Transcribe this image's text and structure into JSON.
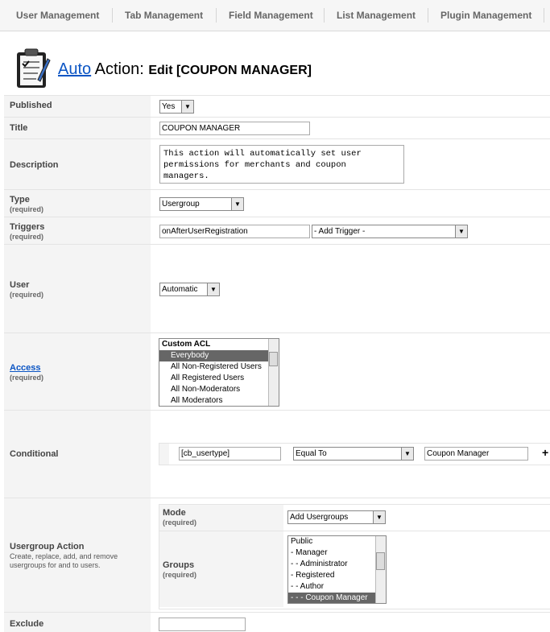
{
  "nav": {
    "tabs": [
      "User Management",
      "Tab Management",
      "Field Management",
      "List Management",
      "Plugin Management"
    ]
  },
  "header": {
    "title_link": "Auto",
    "title_word": "Action:",
    "title_sub": "Edit [COUPON MANAGER]"
  },
  "required_text": "(required)",
  "form": {
    "published": {
      "label": "Published",
      "value": "Yes"
    },
    "title": {
      "label": "Title",
      "value": "COUPON MANAGER"
    },
    "description": {
      "label": "Description",
      "value": "This action will automatically set user\npermissions for merchants and coupon\nmanagers."
    },
    "type": {
      "label": "Type",
      "value": "Usergroup"
    },
    "triggers": {
      "label": "Triggers",
      "value": "onAfterUserRegistration",
      "add_trigger": "- Add Trigger -"
    },
    "user": {
      "label": "User",
      "value": "Automatic"
    },
    "access": {
      "label": "Access",
      "options": [
        "Custom ACL",
        "Everybody",
        "All Non-Registered Users",
        "All Registered Users",
        "All Non-Moderators",
        "All Moderators"
      ],
      "selected": "Everybody"
    },
    "conditional": {
      "label": "Conditional",
      "field": "[cb_usertype]",
      "operator": "Equal To",
      "value": "Coupon Manager",
      "add_symbol": "+"
    },
    "usergroup_action": {
      "label": "Usergroup Action",
      "description": "Create, replace, add, and remove usergroups for and to users.",
      "mode_label": "Mode",
      "mode_value": "Add Usergroups",
      "groups_label": "Groups",
      "groups": [
        "Public",
        "- Manager",
        "- - Administrator",
        "- Registered",
        "- - Author",
        "- - - Coupon Manager"
      ],
      "selected": "- - - Coupon Manager"
    },
    "exclude": {
      "label": "Exclude",
      "value": ""
    }
  }
}
